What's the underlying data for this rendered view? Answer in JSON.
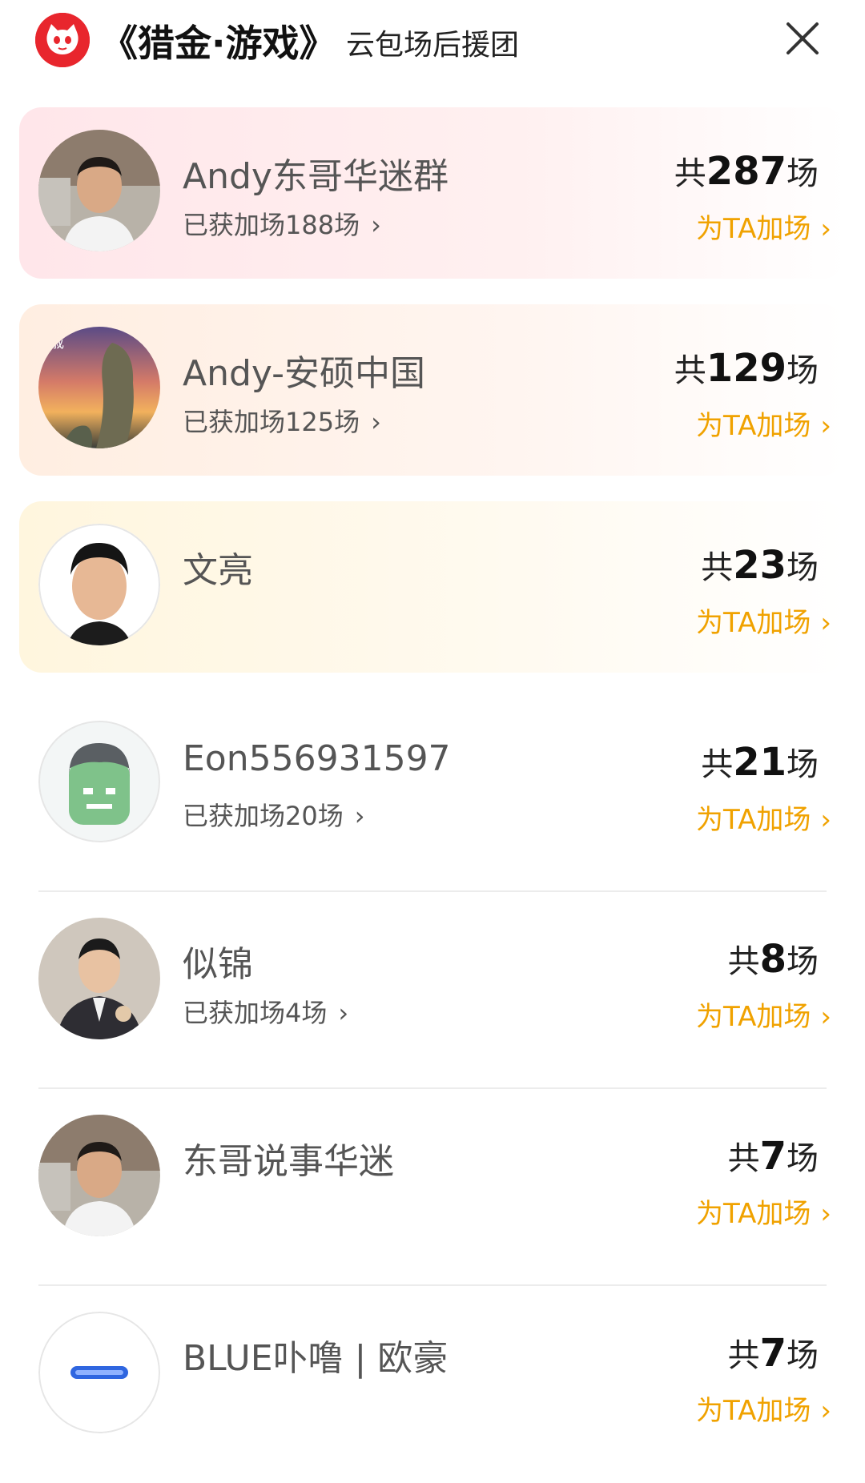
{
  "header": {
    "title": "《猎金·游戏》",
    "subtitle": "云包场后援团",
    "logo_icon": "cat-logo-icon",
    "close_icon": "close-icon",
    "brand_color": "#e8262d"
  },
  "rows": [
    {
      "name": "Andy东哥华迷群",
      "gained": "已获加场188场",
      "total_prefix": "共",
      "total_num": "287",
      "total_suffix": "场",
      "boost": "为TA加场"
    },
    {
      "name": "Andy-安硕中国",
      "gained": "已获加场125场",
      "total_prefix": "共",
      "total_num": "129",
      "total_suffix": "场",
      "boost": "为TA加场"
    },
    {
      "name": "文亮",
      "gained": "",
      "total_prefix": "共",
      "total_num": "23",
      "total_suffix": "场",
      "boost": "为TA加场"
    },
    {
      "name": "Eon556931597",
      "gained": "已获加场20场",
      "total_prefix": "共",
      "total_num": "21",
      "total_suffix": "场",
      "boost": "为TA加场"
    },
    {
      "name": "似锦",
      "gained": "已获加场4场",
      "total_prefix": "共",
      "total_num": "8",
      "total_suffix": "场",
      "boost": "为TA加场"
    },
    {
      "name": "东哥说事华迷",
      "gained": "",
      "total_prefix": "共",
      "total_num": "7",
      "total_suffix": "场",
      "boost": "为TA加场"
    },
    {
      "name": "BLUE卟噜 | 欧豪",
      "gained": "",
      "total_prefix": "共",
      "total_num": "7",
      "total_suffix": "场",
      "boost": "为TA加场"
    }
  ],
  "colors": {
    "accent": "#f0a200",
    "rank1_bg": "#ffe6ea",
    "rank2_bg": "#ffeee1",
    "rank3_bg": "#fff6de"
  }
}
